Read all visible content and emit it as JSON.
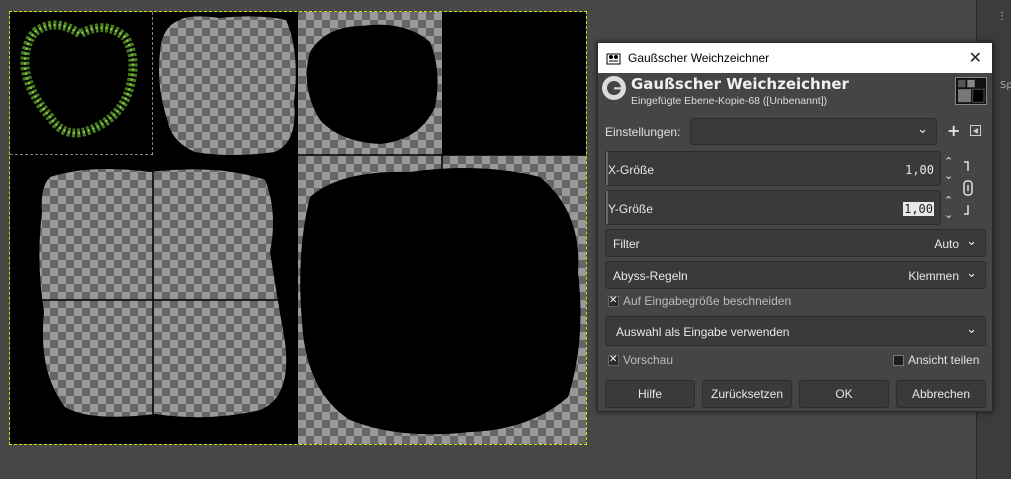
{
  "dialog": {
    "title": "Gaußscher Weichzeichner",
    "header_title": "Gaußscher Weichzeichner",
    "header_subtitle": "Eingefügte Ebene-Kopie-68 ([Unbenannt])",
    "presets_label": "Einstellungen:",
    "presets_value": "",
    "x_size": {
      "label": "X-Größe",
      "value": "1,00"
    },
    "y_size": {
      "label": "Y-Größe",
      "value": "1,00"
    },
    "filter": {
      "label": "Filter",
      "value": "Auto"
    },
    "abyss": {
      "label": "Abyss-Regeln",
      "value": "Klemmen"
    },
    "clip_input": {
      "label": "Auf Eingabegröße beschneiden",
      "checked": true
    },
    "selection_input": {
      "label": "Auswahl als Eingabe verwenden"
    },
    "preview": {
      "label": "Vorschau",
      "checked": true
    },
    "split_view": {
      "label": "Ansicht teilen",
      "checked": false
    },
    "buttons": {
      "help": "Hilfe",
      "reset": "Zurücksetzen",
      "ok": "OK",
      "cancel": "Abbrechen"
    }
  },
  "dock": {
    "tab_fragment": "Sp"
  },
  "icons": [
    "gimp-app-icon",
    "close-icon",
    "gimp-g-icon",
    "chevron-down-icon",
    "plus-icon",
    "menu-arrow-icon",
    "spin-up-icon",
    "spin-down-icon",
    "chain-link-icon",
    "checkbox-icon"
  ],
  "colors": {
    "dialog_bg": "#454545",
    "canvas_black": "#000000",
    "glow_green": "#5fa02a",
    "selection_outline": "#d8d800"
  }
}
